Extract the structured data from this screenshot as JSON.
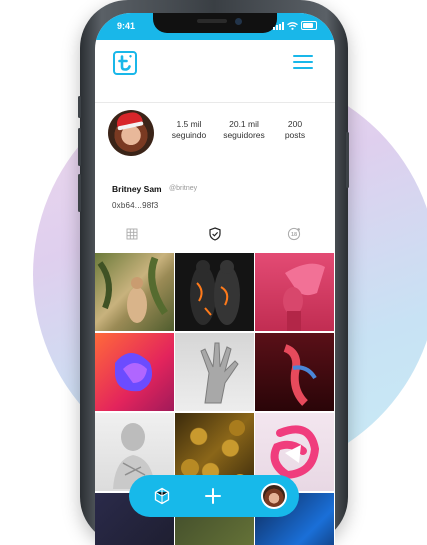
{
  "status_bar": {
    "time": "9:41"
  },
  "profile": {
    "stats": [
      {
        "value": "1.5 mil",
        "label": "seguindo"
      },
      {
        "value": "20.1 mil",
        "label": "seguidores"
      },
      {
        "value": "200",
        "label": "posts"
      }
    ],
    "name": "Britney Sam",
    "handle": "@britney",
    "wallet": "0xb64...98f3"
  },
  "tabs": [
    {
      "icon": "grid-icon",
      "active": false
    },
    {
      "icon": "shield-check-icon",
      "active": true
    },
    {
      "icon": "nft-badge-icon",
      "active": false
    }
  ],
  "grid_items": [
    "jungle-figure-artwork",
    "glowing-figures-artwork",
    "pink-head-artwork",
    "purple-blob-artwork",
    "metal-hand-artwork",
    "red-figure-artwork",
    "marble-bust-artwork",
    "gold-spheres-artwork",
    "pink-ribbon-artwork"
  ],
  "colors": {
    "accent": "#19b7e9",
    "background": "#ffffff"
  }
}
